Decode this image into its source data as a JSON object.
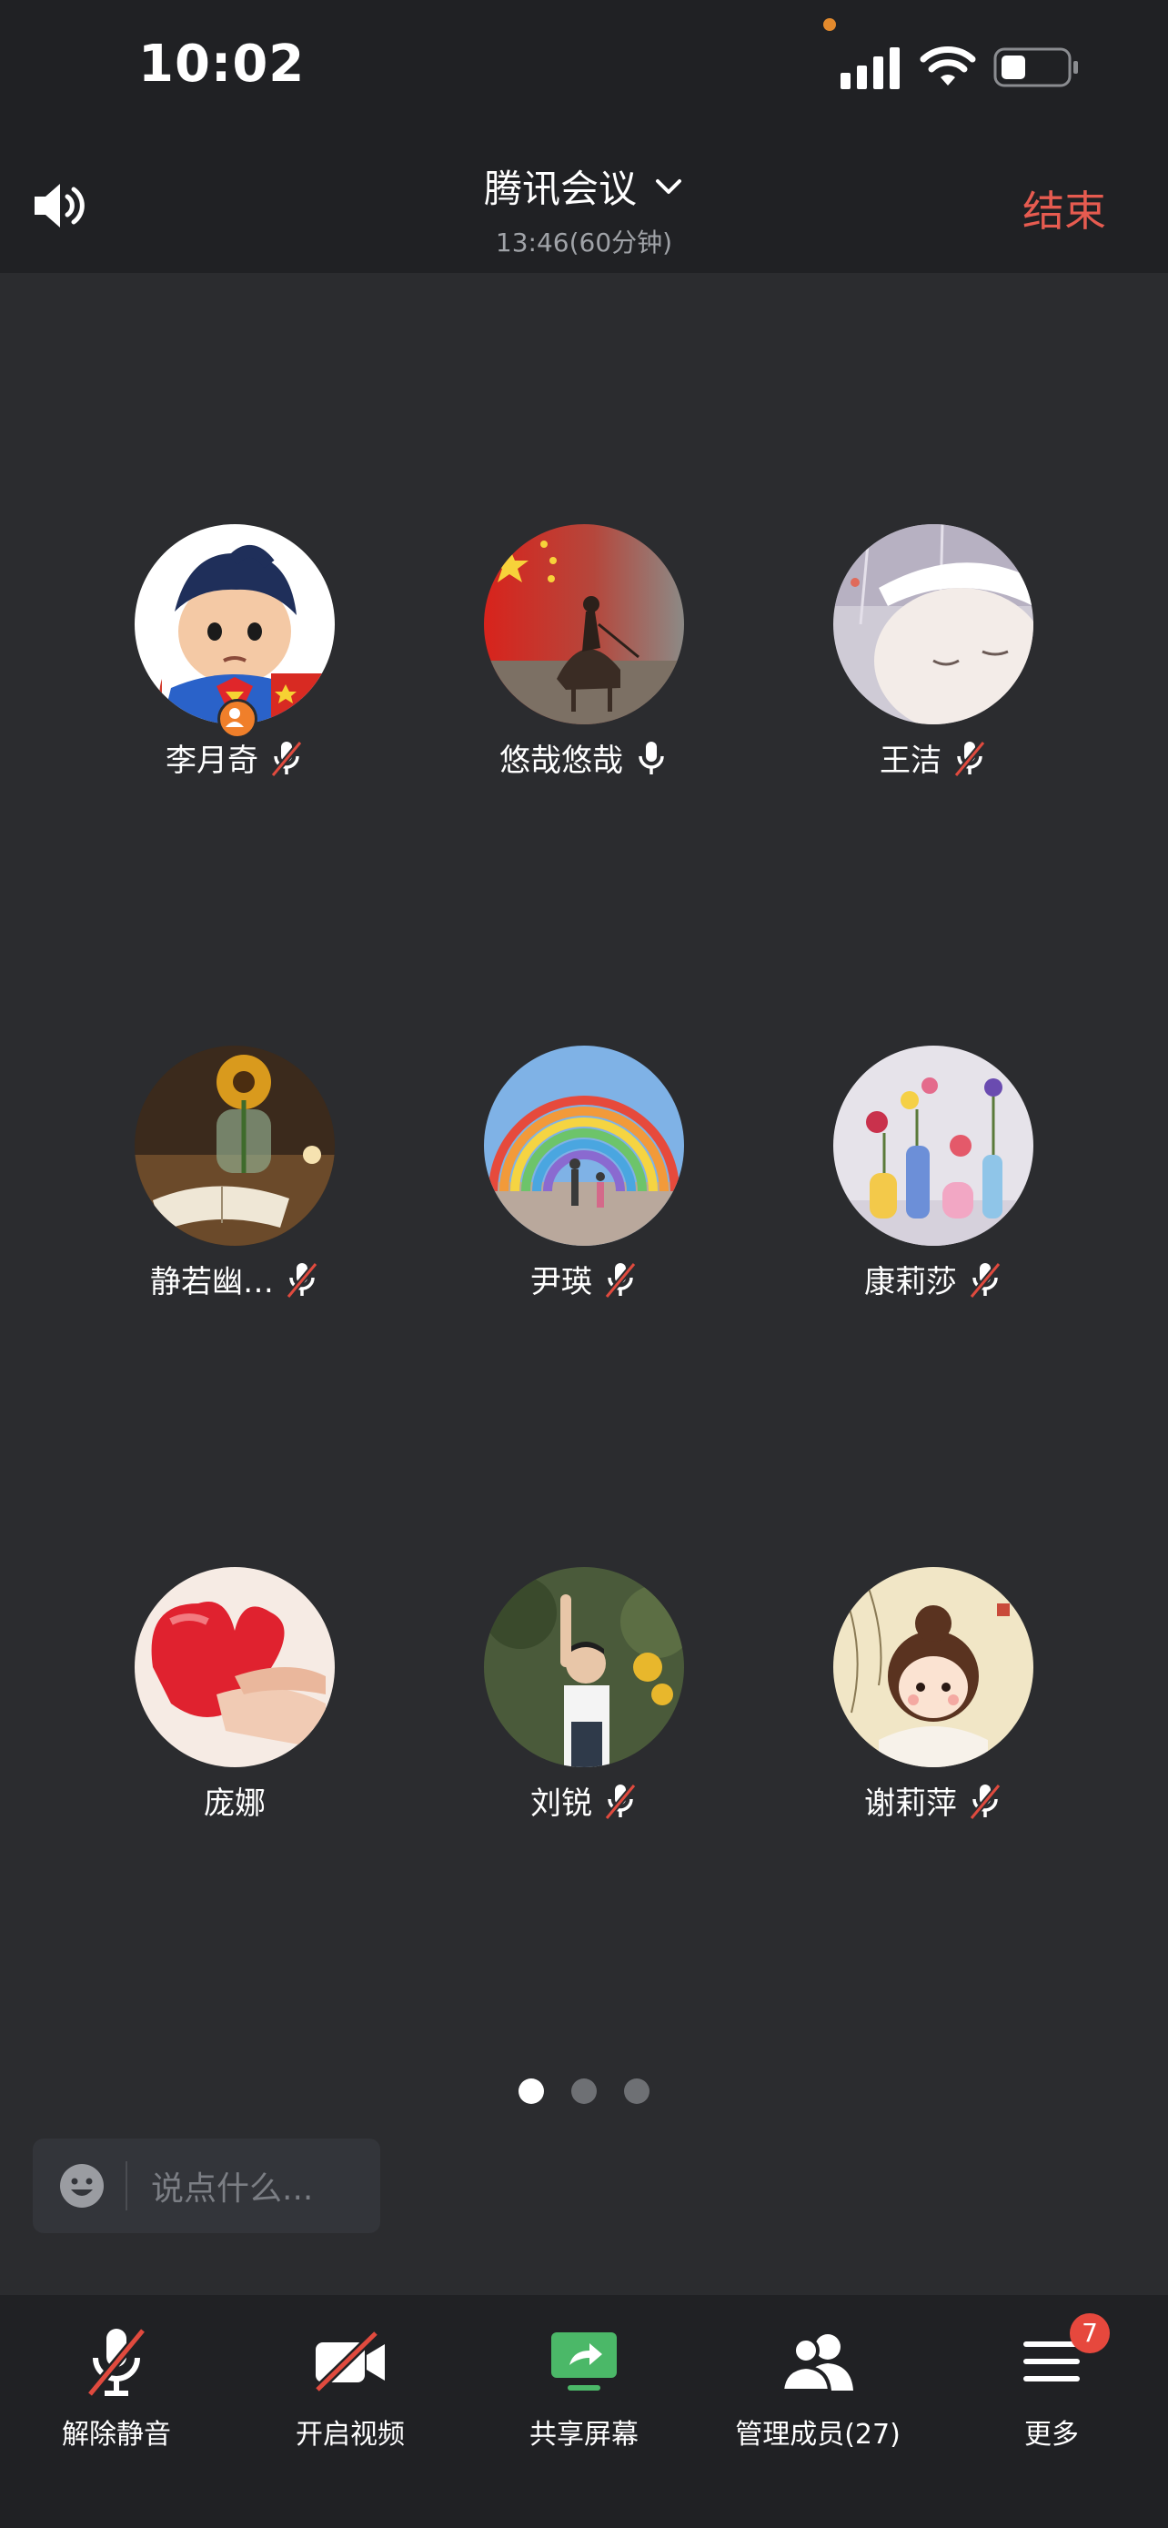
{
  "status_bar": {
    "time": "10:02"
  },
  "header": {
    "title": "腾讯会议",
    "subtitle": "13:46(60分钟)",
    "end_label": "结束"
  },
  "participants": [
    {
      "name": "李月奇",
      "mic": "muted",
      "host": true
    },
    {
      "name": "悠哉悠哉",
      "mic": "on",
      "host": false
    },
    {
      "name": "王洁",
      "mic": "muted",
      "host": false
    },
    {
      "name": "静若幽…",
      "mic": "muted",
      "host": false
    },
    {
      "name": "尹瑛",
      "mic": "muted",
      "host": false
    },
    {
      "name": "康莉莎",
      "mic": "muted",
      "host": false
    },
    {
      "name": "庞娜",
      "mic": "none",
      "host": false
    },
    {
      "name": "刘锐",
      "mic": "muted",
      "host": false
    },
    {
      "name": "谢莉萍",
      "mic": "muted",
      "host": false
    }
  ],
  "pager": {
    "pages": 3,
    "active": 1
  },
  "chat": {
    "placeholder": "说点什么..."
  },
  "toolbar": {
    "unmute_label": "解除静音",
    "video_label": "开启视频",
    "share_label": "共享屏幕",
    "members_label": "管理成员(27)",
    "more_label": "更多",
    "more_badge": "7"
  },
  "colors": {
    "end": "#e65b50",
    "share_green": "#4bb868",
    "badge_red": "#e6483d",
    "host_orange": "#f07f2a"
  }
}
